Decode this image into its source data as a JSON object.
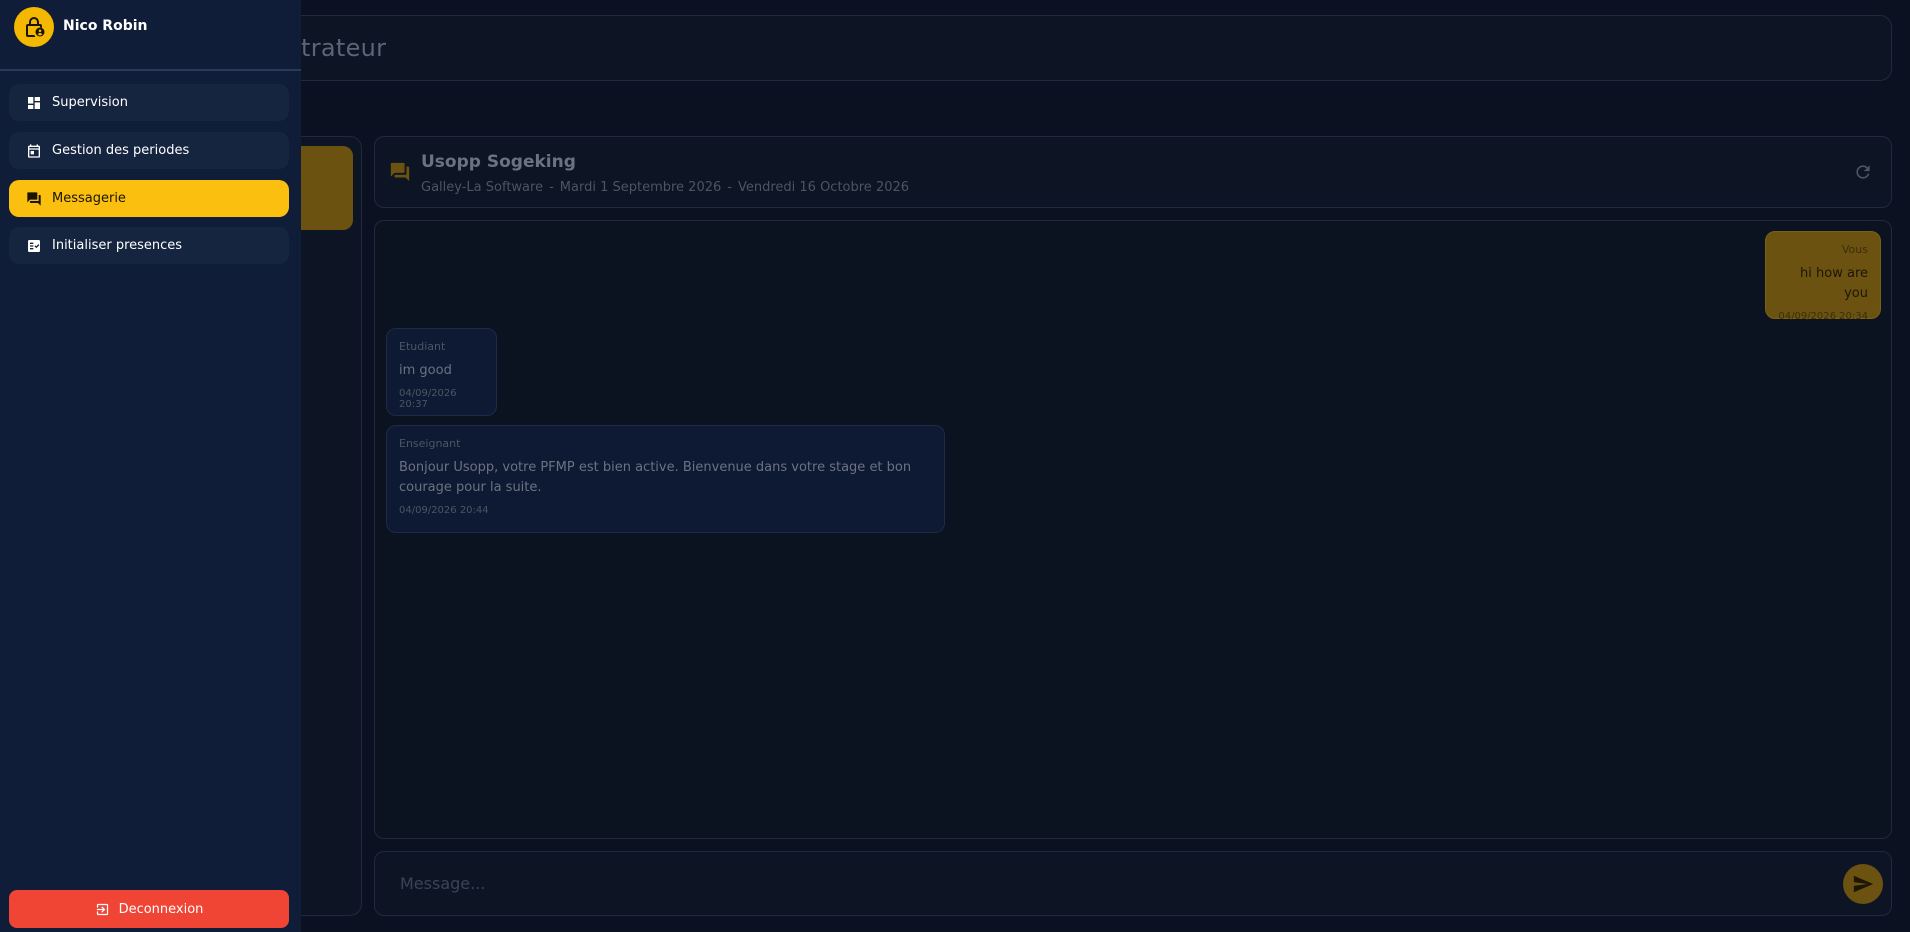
{
  "user": {
    "name": "Nico Robin",
    "avatar_icon": "lock-person-icon"
  },
  "sidebar": {
    "items": [
      {
        "label": "Supervision",
        "icon": "dashboard-icon",
        "active": false
      },
      {
        "label": "Gestion des periodes",
        "icon": "calendar-icon",
        "active": false
      },
      {
        "label": "Messagerie",
        "icon": "forum-icon",
        "active": true
      },
      {
        "label": "Initialiser presences",
        "icon": "checklist-icon",
        "active": false
      }
    ],
    "logout_label": "Deconnexion"
  },
  "topbar": {
    "title_visible": "trateur"
  },
  "conversation": {
    "name": "Usopp Sogeking",
    "company": "Galley-La Software",
    "start_date": "Mardi 1 Septembre 2026",
    "end_date": "Vendredi 16 Octobre 2026",
    "separator": "-"
  },
  "messages": [
    {
      "author": "Vous",
      "text": "hi how are you",
      "time": "04/09/2026 20:34",
      "mine": true
    },
    {
      "author": "Etudiant",
      "text": "im good",
      "time": "04/09/2026 20:37",
      "mine": false
    },
    {
      "author": "Enseignant",
      "text": "Bonjour Usopp, votre PFMP est bien active. Bienvenue dans votre stage et bon courage pour la suite.",
      "time": "04/09/2026 20:44",
      "mine": false
    }
  ],
  "composer": {
    "placeholder": "Message...",
    "value": ""
  },
  "colors": {
    "accent": "#fbbf0f",
    "drawer_bg": "#0f1d38",
    "logout": "#f04434",
    "page_bg": "#0b1120"
  }
}
